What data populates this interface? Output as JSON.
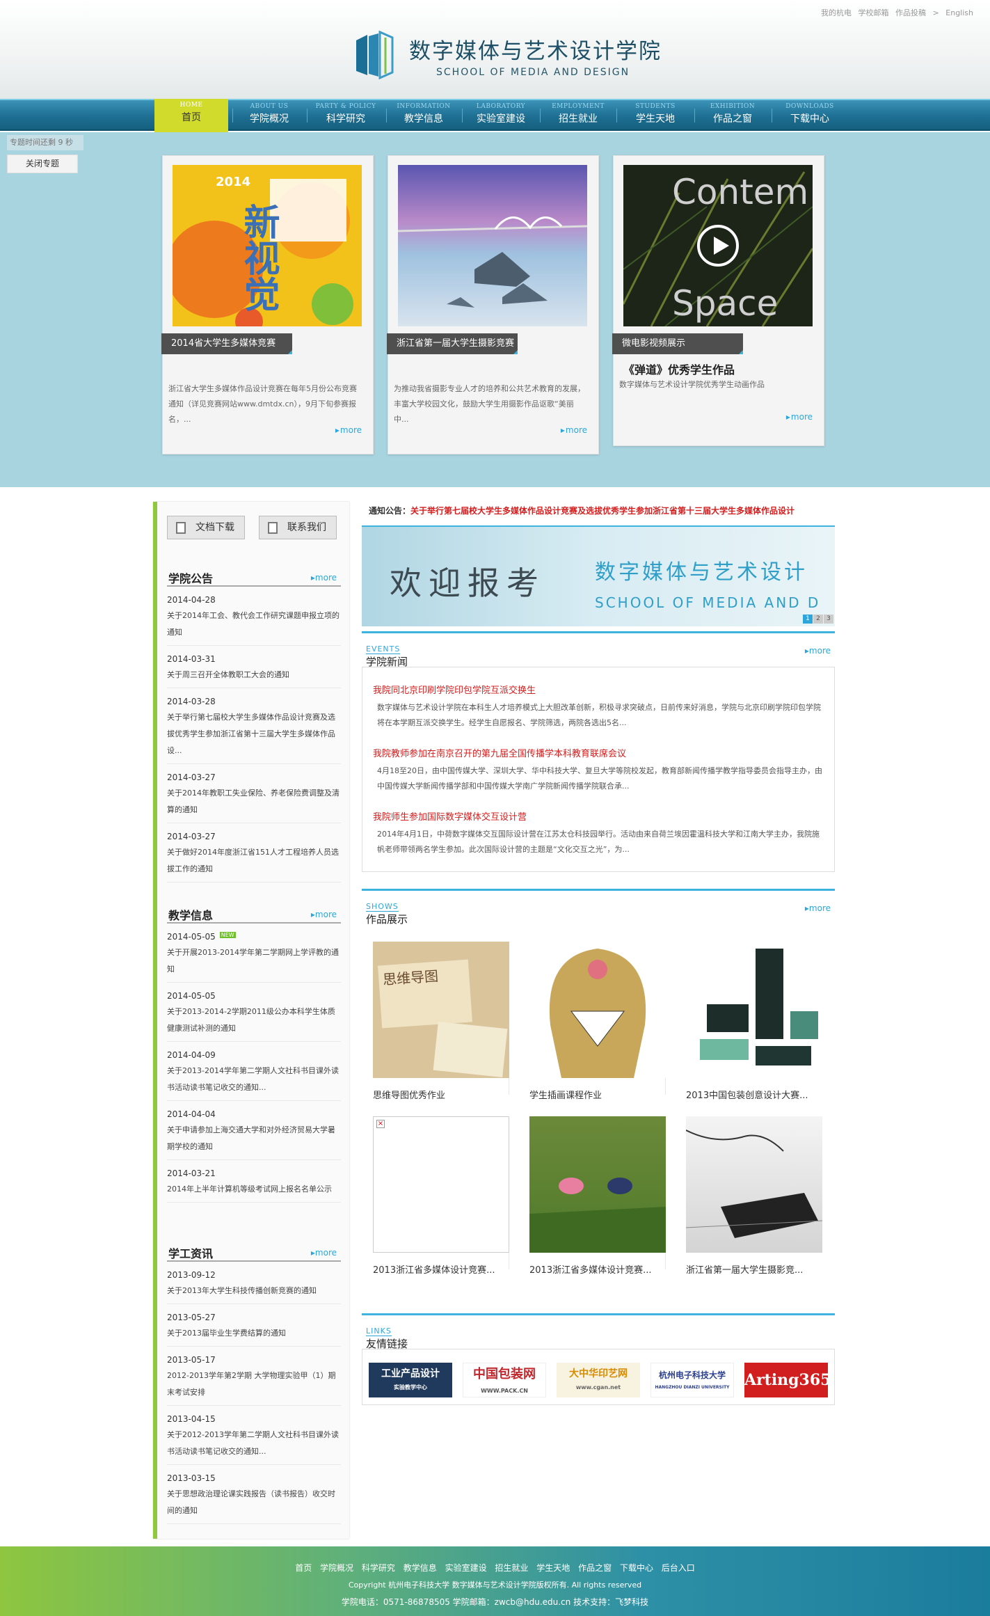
{
  "toplinks": [
    "我的杭电",
    "学校邮箱",
    "作品投稿",
    ">",
    "English"
  ],
  "header": {
    "title": "数字媒体与艺术设计学院",
    "subtitle": "SCHOOL OF MEDIA AND DESIGN"
  },
  "nav": [
    {
      "en": "HOME",
      "cn": "首页"
    },
    {
      "en": "ABOUT US",
      "cn": "学院概况"
    },
    {
      "en": "PARTY & POLICY",
      "cn": "科学研究"
    },
    {
      "en": "INFORMATION",
      "cn": "教学信息"
    },
    {
      "en": "LABORATORY",
      "cn": "实验室建设"
    },
    {
      "en": "EMPLOYMENT",
      "cn": "招生就业"
    },
    {
      "en": "STUDENTS",
      "cn": "学生天地"
    },
    {
      "en": "EXHIBITION",
      "cn": "作品之窗"
    },
    {
      "en": "DOWNLOADS",
      "cn": "下载中心"
    }
  ],
  "feature": {
    "timer": "专题时间还剩 9 秒",
    "close": "关闭专题",
    "cards": [
      {
        "label": "2014省大学生多媒体竞赛",
        "subtitle": "",
        "desc": "浙江省大学生多媒体作品设计竞赛在每年5月份公布竞赛通知（详见竞赛网站www.dmtdx.cn），9月下旬参赛报名，...",
        "more": "more",
        "img_text_1": "新视觉",
        "img_text_2": "2014"
      },
      {
        "label": "浙江省第一届大学生摄影竞赛",
        "subtitle": "",
        "desc": "为推动我省摄影专业人才的培养和公共艺术教育的发展，丰富大学校园文化，鼓励大学生用摄影作品讴歌“美丽中...",
        "more": "more"
      },
      {
        "label": "微电影视频展示",
        "subtitle": "《弹道》优秀学生作品",
        "desc": "数字媒体与艺术设计学院优秀学生动画作品",
        "more": "more",
        "img_text_1": "Contem",
        "img_text_2": "Space"
      }
    ]
  },
  "left": {
    "btn_docs": "文档下载",
    "btn_contact": "联系我们",
    "sections": [
      {
        "title": "学院公告",
        "more": "more",
        "items": [
          {
            "date": "2014-04-28",
            "text": "关于2014年工会、教代会工作研究课题申报立项的通知"
          },
          {
            "date": "2014-03-31",
            "text": "关于周三召开全体教职工大会的通知"
          },
          {
            "date": "2014-03-28",
            "text": "关于举行第七届校大学生多媒体作品设计竞赛及选拔优秀学生参加浙江省第十三届大学生多媒体作品设..."
          },
          {
            "date": "2014-03-27",
            "text": "关于2014年教职工失业保险、养老保险费调整及清算的通知"
          },
          {
            "date": "2014-03-27",
            "text": "关于做好2014年度浙江省151人才工程培养人员选拔工作的通知"
          }
        ]
      },
      {
        "title": "教学信息",
        "more": "more",
        "new_badge": "NEW",
        "items": [
          {
            "date": "2014-05-05",
            "text": "关于开展2013-2014学年第二学期网上学评教的通知"
          },
          {
            "date": "2014-05-05",
            "text": "关于2013-2014-2学期2011级公办本科学生体质健康测试补测的通知"
          },
          {
            "date": "2014-04-09",
            "text": "关于2013-2014学年第二学期人文社科书目课外读书活动读书笔记收交的通知..."
          },
          {
            "date": "2014-04-04",
            "text": "关于申请参加上海交通大学和对外经济贸易大学暑期学校的通知"
          },
          {
            "date": "2014-03-21",
            "text": "2014年上半年计算机等级考试网上报名名单公示"
          }
        ]
      },
      {
        "title": "学工资讯",
        "more": "more",
        "items": [
          {
            "date": "2013-09-12",
            "text": "关于2013年大学生科技传播创新竞赛的通知"
          },
          {
            "date": "2013-05-27",
            "text": "关于2013届毕业生学费结算的通知"
          },
          {
            "date": "2013-05-17",
            "text": "2012-2013学年第2学期 大学物理实验甲（1）期末考试安排"
          },
          {
            "date": "2013-04-15",
            "text": "关于2012-2013学年第二学期人文社科书目课外读书活动读书笔记收交的通知..."
          },
          {
            "date": "2013-03-15",
            "text": "关于思想政治理论课实践报告（读书报告）收交时间的通知"
          }
        ]
      }
    ]
  },
  "notice": {
    "label": "通知公告：",
    "text": "关于举行第七届校大学生多媒体作品设计竞赛及选拔优秀学生参加浙江省第十三届大学生多媒体作品设计"
  },
  "banner": {
    "welcome": "欢迎报考",
    "title": "数字媒体与艺术设计",
    "subtitle": "SCHOOL OF MEDIA AND D",
    "pages": [
      "1",
      "2",
      "3"
    ]
  },
  "events": {
    "tag": "EVENTS",
    "title": "学院新闻",
    "more": "more",
    "items": [
      {
        "title": "我院同北京印刷学院印包学院互派交换生",
        "desc": "数字媒体与艺术设计学院在本科生人才培养模式上大胆改革创新，积极寻求突破点，日前传来好消息，学院与北京印刷学院印包学院将在本学期互派交换学生。经学生自愿报名、学院筛选，两院各选出5名..."
      },
      {
        "title": "我院教师参加在南京召开的第九届全国传播学本科教育联席会议",
        "desc": "4月18至20日，由中国传媒大学、深圳大学、华中科技大学、复旦大学等院校发起，教育部新闻传播学教学指导委员会指导主办，由中国传媒大学新闻传播学部和中国传媒大学南广学院新闻传播学院联合承..."
      },
      {
        "title": "我院师生参加国际数字媒体交互设计营",
        "desc": "2014年4月1日，中荷数字媒体交互国际设计营在江苏太仓科技园举行。活动由来自荷兰埃因霍温科技大学和江南大学主办，我院施帆老师带领两名学生参加。此次国际设计营的主题是“文化交互之光”，为..."
      }
    ]
  },
  "shows": {
    "tag": "SHOWS",
    "title": "作品展示",
    "more": "more",
    "items": [
      {
        "caption": "思维导图优秀作业",
        "img_text": "思维导图"
      },
      {
        "caption": "学生插画课程作业"
      },
      {
        "caption": "2013中国包装创意设计大赛..."
      },
      {
        "caption": "2013浙江省多媒体设计竞赛..."
      },
      {
        "caption": "2013浙江省多媒体设计竞赛..."
      },
      {
        "caption": "浙江省第一届大学生摄影竞..."
      }
    ]
  },
  "links": {
    "tag": "LINKS",
    "title": "友情链接",
    "logos": [
      {
        "text": "工业产品设计",
        "sub": "实验教学中心"
      },
      {
        "text": "中国包装网",
        "sub": "WWW.PACK.CN"
      },
      {
        "text": "大中华印艺网",
        "sub": "www.cgan.net"
      },
      {
        "text": "杭州电子科技大学",
        "sub": "HANGZHOU DIANZI UNIVERSITY"
      },
      {
        "text": "Arting365",
        "sub": ""
      }
    ]
  },
  "footer": {
    "links": [
      "首页",
      "学院概况",
      "科学研究",
      "教学信息",
      "实验室建设",
      "招生就业",
      "学生天地",
      "作品之窗",
      "下载中心",
      "后台入口"
    ],
    "copyright": "Copyright 杭州电子科技大学 数字媒体与艺术设计学院版权所有. All rights reserved",
    "info": "学院电话：0571-86878505 学院邮箱：zwcb@hdu.edu.cn 技术支持：飞梦科技"
  }
}
